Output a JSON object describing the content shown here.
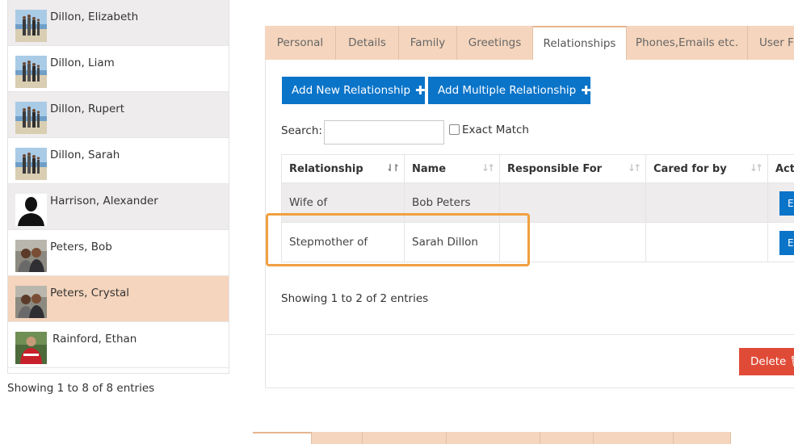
{
  "people": [
    {
      "name": "Dillon, Elizabeth",
      "avatar": "beach-family-photo"
    },
    {
      "name": "Dillon, Liam",
      "avatar": "beach-family-photo"
    },
    {
      "name": "Dillon, Rupert",
      "avatar": "beach-family-photo"
    },
    {
      "name": "Dillon, Sarah",
      "avatar": "beach-family-photo"
    },
    {
      "name": "Harrison, Alexander",
      "avatar": "silhouette-placeholder"
    },
    {
      "name": "Peters, Bob",
      "avatar": "couple-photo"
    },
    {
      "name": "Peters, Crystal",
      "avatar": "couple-photo"
    },
    {
      "name": "Rainford, Ethan",
      "avatar": "person-red-sweater-photo"
    }
  ],
  "list_footer": "Showing 1 to 8 of 8 entries",
  "tabs": [
    "Personal",
    "Details",
    "Family",
    "Greetings",
    "Relationships",
    "Phones,Emails etc.",
    "User F"
  ],
  "active_tab": "Relationships",
  "buttons": {
    "add_new": "Add New Relationship",
    "add_multiple": "Add Multiple Relationship",
    "delete": "Delete",
    "edit": "E"
  },
  "search": {
    "label": "Search:",
    "value": "",
    "exact_match_label": "Exact Match",
    "exact_match_checked": false
  },
  "table": {
    "columns": [
      "Relationship",
      "Name",
      "Responsible For",
      "Cared for by",
      "Actio"
    ],
    "rows": [
      {
        "relationship": "Wife of",
        "name": "Bob Peters",
        "responsible_for": "",
        "cared_for_by": ""
      },
      {
        "relationship": "Stepmother of",
        "name": "Sarah Dillon",
        "responsible_for": "",
        "cared_for_by": ""
      }
    ],
    "info": "Showing 1 to 2 of 2 entries"
  },
  "colors": {
    "accent_tab": "#f5d5bd",
    "button_blue": "#0a74c9",
    "delete_red": "#e04b37",
    "highlight_orange": "#f0a040",
    "row_stripe": "#eeeced"
  }
}
